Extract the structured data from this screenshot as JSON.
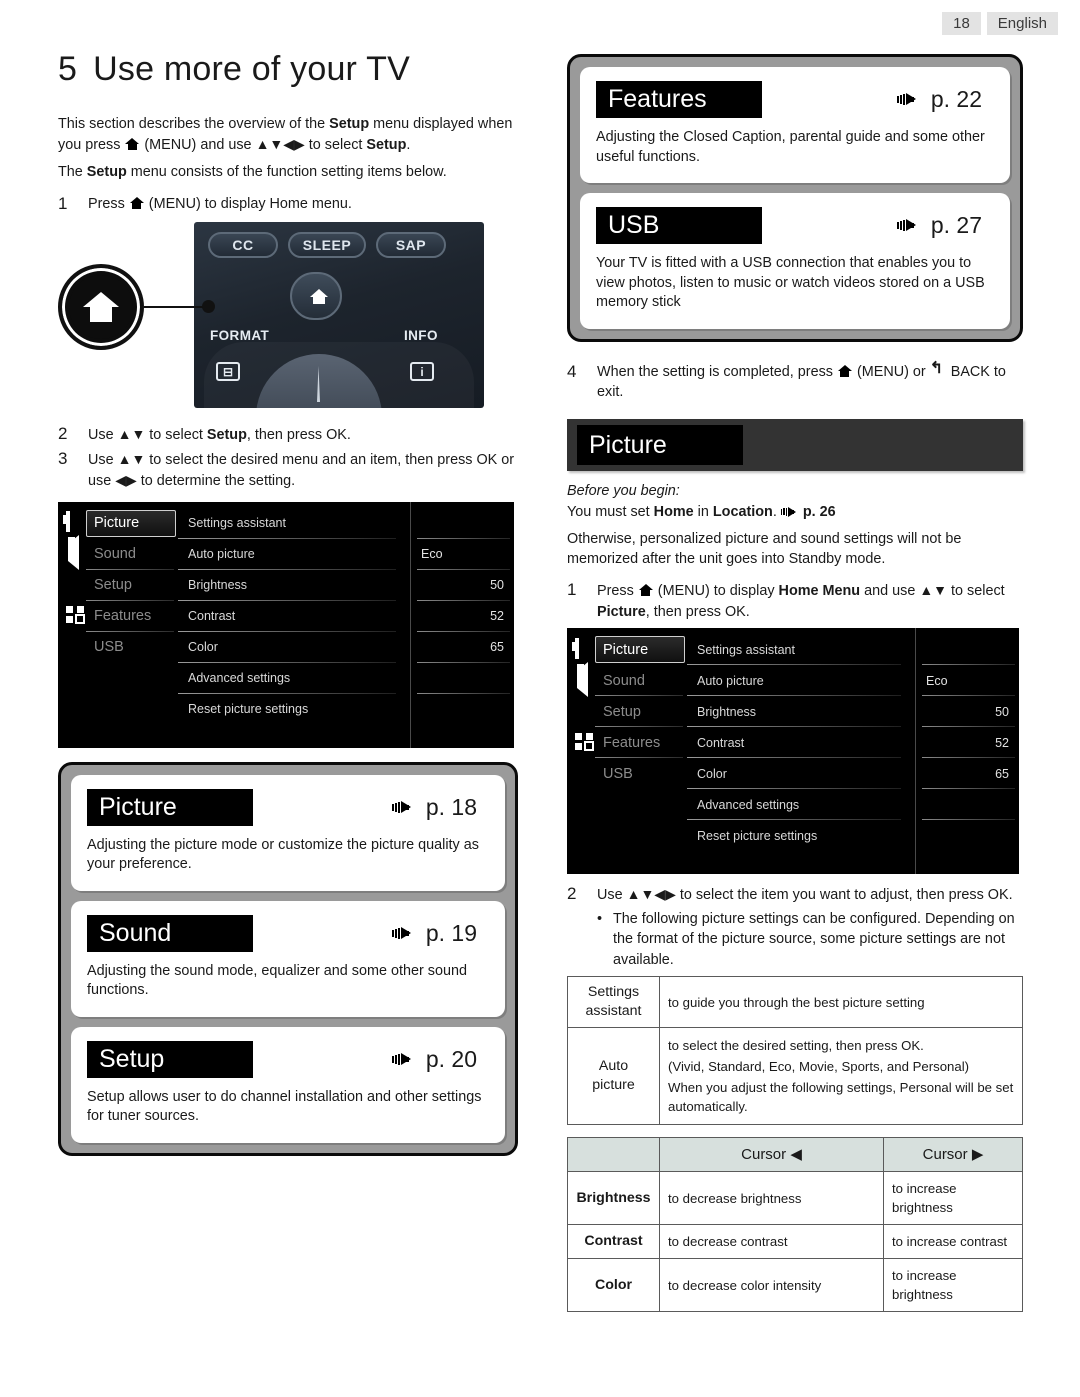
{
  "header": {
    "page_number": "18",
    "language": "English"
  },
  "left": {
    "title_number": "5",
    "title_text": "Use more of your TV",
    "intro_1a": "This section describes the overview of the ",
    "intro_1b": "Setup",
    "intro_1c": " menu displayed when you press ",
    "intro_1d": " (MENU) and use ",
    "intro_1e": " to select ",
    "intro_1f": "Setup",
    "intro_2a": "The ",
    "intro_2b": "Setup",
    "intro_2c": " menu consists of the function setting items below.",
    "step1_num": "1",
    "step1_a": "Press ",
    "step1_b": " (MENU) to display Home menu.",
    "remote": {
      "cc": "CC",
      "sleep": "SLEEP",
      "sap": "SAP",
      "format": "FORMAT",
      "info": "INFO"
    },
    "step2_num": "2",
    "step2_a": "Use ",
    "step2_b": " to select ",
    "step2_c": "Setup",
    "step2_d": ", then press OK.",
    "step3_num": "3",
    "step3_a": "Use ",
    "step3_b": " to select the desired menu and an item, then press OK or use ",
    "step3_c": " to determine the setting.",
    "cards": [
      {
        "title": "Picture",
        "page": "p. 18",
        "desc": "Adjusting the picture mode or customize the picture quality as your preference."
      },
      {
        "title": "Sound",
        "page": "p. 19",
        "desc": "Adjusting the sound mode, equalizer and some other sound functions."
      },
      {
        "title": "Setup",
        "page": "p. 20",
        "desc": "Setup allows user to do channel installation and other settings for tuner sources."
      }
    ]
  },
  "right": {
    "cards": [
      {
        "title": "Features",
        "page": "p. 22",
        "desc": "Adjusting the Closed Caption, parental guide and some other useful functions."
      },
      {
        "title": "USB",
        "page": "p. 27",
        "desc": "Your TV is fitted with a USB connection that enables you to view photos, listen to music or watch videos stored on a USB memory stick"
      }
    ],
    "step4_num": "4",
    "step4_a": "When the setting is completed, press ",
    "step4_b": " (MENU) or ",
    "step4_c": " BACK to exit.",
    "banner_title": "Picture",
    "before_label": "Before you begin:",
    "before_1a": "You must set ",
    "before_1b": "Home",
    "before_1c": " in ",
    "before_1d": "Location",
    "before_1e": ". ",
    "before_1f": "p. 26",
    "before_2": "Otherwise, personalized picture and sound settings will not be memorized after the unit goes into Standby mode.",
    "step1_num": "1",
    "step1_a": "Press ",
    "step1_b": " (MENU) to display ",
    "step1_c": "Home Menu",
    "step1_d": " and use ",
    "step1_e": " to select ",
    "step1_f": "Picture",
    "step1_g": ", then press OK.",
    "step2_num": "2",
    "step2_a": "Use ",
    "step2_b": " to select the item you want to adjust, then press OK.",
    "bullet_1": "The following picture settings can be configured. Depending on the format of the picture source, some picture settings are not available.",
    "table_settings": [
      {
        "key": "Settings assistant",
        "lines": [
          "to guide you through the best picture setting"
        ]
      },
      {
        "key": "Auto picture",
        "lines": [
          "to select the desired setting, then press OK.",
          "(Vivid, Standard, Eco, Movie, Sports, and Personal)",
          "When you adjust the following settings, Personal will be set automatically."
        ]
      }
    ],
    "cursor_table": {
      "headers": [
        "",
        "Cursor ◀",
        "Cursor ▶"
      ],
      "rows": [
        {
          "key": "Brightness",
          "left": "to decrease brightness",
          "right": "to increase brightness"
        },
        {
          "key": "Contrast",
          "left": "to decrease contrast",
          "right": "to increase contrast"
        },
        {
          "key": "Color",
          "left": "to decrease color intensity",
          "right": "to increase brightness"
        }
      ]
    }
  },
  "osd": {
    "sidebar": [
      {
        "label": "Picture",
        "icon": "picture-icon",
        "selected": true
      },
      {
        "label": "Sound",
        "icon": "speaker-icon",
        "selected": false
      },
      {
        "label": "Setup",
        "icon": "gear-icon",
        "selected": false
      },
      {
        "label": "Features",
        "icon": "blocks-icon",
        "selected": false
      },
      {
        "label": "USB",
        "icon": "usb-icon",
        "selected": false
      }
    ],
    "items": [
      {
        "label": "Settings assistant",
        "value": ""
      },
      {
        "label": "Auto picture",
        "value": "Eco",
        "align": "left"
      },
      {
        "label": "Brightness",
        "value": "50",
        "align": "right"
      },
      {
        "label": "Contrast",
        "value": "52",
        "align": "right"
      },
      {
        "label": "Color",
        "value": "65",
        "align": "right"
      },
      {
        "label": "Advanced settings",
        "value": ""
      },
      {
        "label": "Reset picture settings",
        "value": ""
      }
    ]
  },
  "colors": {
    "chip_bg": "#000000",
    "group_bg": "#9a9a9a",
    "banner_bg": "#333333",
    "table_header_bg": "#d7e0dd"
  }
}
